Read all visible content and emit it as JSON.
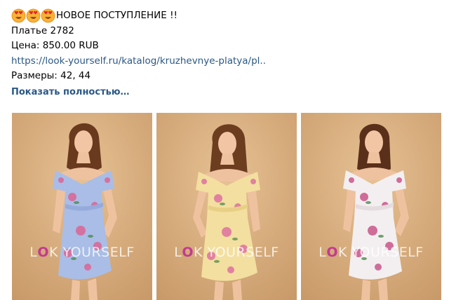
{
  "post": {
    "headline_emoji": [
      "heart-eyes-emoji",
      "heart-eyes-emoji",
      "heart-eyes-emoji"
    ],
    "headline": "НОВОЕ ПОСТУПЛЕНИЕ !!",
    "product": "Платье 2782",
    "price": "Цена: 850.00 RUB",
    "link": "https://look-yourself.ru/katalog/kruzhevnye-platya/pl..",
    "sizes": "Размеры: 42, 44",
    "show_more": "Показать полностью…"
  },
  "photos": [
    {
      "dress_color": "#a9bde6",
      "flower_color": "#d86a9a",
      "watermark_prefix": "L",
      "watermark_o": "O",
      "watermark_suffix": "K YOURSELF"
    },
    {
      "dress_color": "#f3dfa0",
      "flower_color": "#e0779f",
      "watermark_prefix": "L",
      "watermark_o": "O",
      "watermark_suffix": "K YOURSELF"
    },
    {
      "dress_color": "#f3eff0",
      "flower_color": "#cc6090",
      "watermark_prefix": "L",
      "watermark_o": "O",
      "watermark_suffix": "K YOURSELF"
    }
  ],
  "colors": {
    "link": "#2a5885",
    "background_photo": "#d8ae7e"
  }
}
